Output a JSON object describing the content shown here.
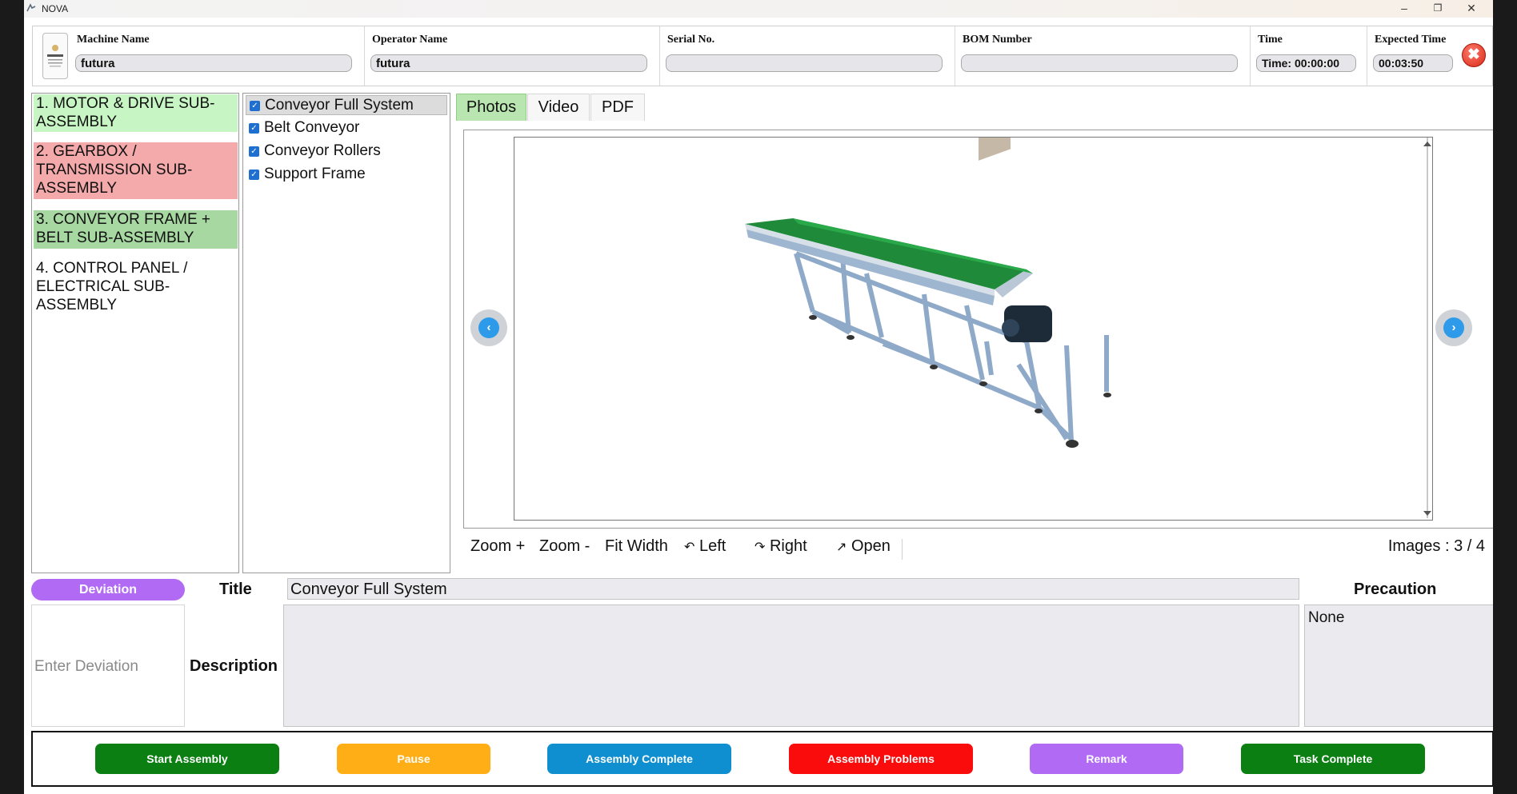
{
  "window": {
    "title": "NOVA",
    "minimize": "–",
    "restore": "❐",
    "close": "✕"
  },
  "header": {
    "machine_name": {
      "label": "Machine Name",
      "value": "futura"
    },
    "operator_name": {
      "label": "Operator Name",
      "value": "futura"
    },
    "serial_no": {
      "label": "Serial No.",
      "value": ""
    },
    "bom_number": {
      "label": "BOM Number",
      "value": ""
    },
    "time": {
      "label": "Time",
      "value": "Time: 00:00:00"
    },
    "expected_time": {
      "label": "Expected Time",
      "value": "00:03:50"
    },
    "close_glyph": "✖"
  },
  "steps": [
    {
      "label": "1. MOTOR & DRIVE SUB-ASSEMBLY",
      "color": "#c8f5c4"
    },
    {
      "label": "2. GEARBOX / TRANSMISSION SUB-ASSEMBLY",
      "color": "#f4a9ab"
    },
    {
      "label": "3. CONVEYOR FRAME + BELT SUB-ASSEMBLY",
      "color": "#a7d8a1"
    },
    {
      "label": "4. CONTROL PANEL / ELECTRICAL SUB-ASSEMBLY",
      "color": "#ffffff"
    }
  ],
  "parts": [
    {
      "label": "Conveyor Full System",
      "checked": true,
      "selected": true
    },
    {
      "label": "Belt Conveyor",
      "checked": true,
      "selected": false
    },
    {
      "label": "Conveyor Rollers",
      "checked": true,
      "selected": false
    },
    {
      "label": "Support Frame",
      "checked": true,
      "selected": false
    }
  ],
  "tabs": {
    "photos": "Photos",
    "video": "Video",
    "pdf": "PDF",
    "active": "photos"
  },
  "toolbar": {
    "zoom_in": "Zoom +",
    "zoom_out": "Zoom -",
    "fit_width": "Fit Width",
    "left": "Left",
    "right": "Right",
    "open": "Open",
    "images_count": "Images : 3 / 4",
    "rotate_left_glyph": "↶",
    "rotate_right_glyph": "↷",
    "open_glyph": "↗"
  },
  "nav": {
    "prev_glyph": "‹",
    "next_glyph": "›"
  },
  "details": {
    "deviation_button": "Deviation",
    "deviation_placeholder": "Enter Deviation",
    "title_label": "Title",
    "title_value": "Conveyor Full System",
    "description_label": "Description",
    "description_value": "",
    "precaution_label": "Precaution",
    "precaution_value": "None"
  },
  "actions": [
    {
      "label": "Start Assembly",
      "color": "#0b7f12"
    },
    {
      "label": "Pause",
      "color": "#ffae16"
    },
    {
      "label": "Assembly Complete",
      "color": "#0f8fd0"
    },
    {
      "label": "Assembly Problems",
      "color": "#fb0c0c"
    },
    {
      "label": "Remark",
      "color": "#b16af4"
    },
    {
      "label": "Task Complete",
      "color": "#0b7f12"
    }
  ],
  "colors": {
    "tab_active": "#b9e6b0",
    "deviation": "#b16af4",
    "nav_arrow": "#2d9bea"
  }
}
